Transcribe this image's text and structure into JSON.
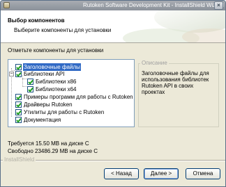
{
  "window": {
    "title": "Rutoken Software Development Kit - InstallShield Wizard",
    "close_glyph": "×"
  },
  "header": {
    "title": "Выбор компонентов",
    "subtitle": "Выберите компоненты для установки"
  },
  "instruction": "Отметьте компоненты для установки",
  "components": [
    {
      "label": "Заголовочные файлы",
      "checked": true,
      "selected": true
    },
    {
      "label": "Библиотеки API",
      "checked": true,
      "expanded": true
    },
    {
      "label": "Библиотеки x86",
      "checked": true
    },
    {
      "label": "Библиотеки x64",
      "checked": true
    },
    {
      "label": "Примеры программ для работы с Rutoken",
      "checked": true
    },
    {
      "label": "Драйверы Rutoken",
      "checked": true
    },
    {
      "label": "Утилиты для работы с Rutoken",
      "checked": true
    },
    {
      "label": "Документация",
      "checked": true
    }
  ],
  "tree_expander": "−",
  "description": {
    "legend": "Описание",
    "text": "Заголовочные файлы для использования библиотек Rutoken API в своих проектах"
  },
  "space": {
    "required": "Требуется 15.50 MB на диске C",
    "free": "Свободно 23486.29 MB на диске C"
  },
  "brand": "InstallShield",
  "buttons": {
    "back": "< Назад",
    "next": "Далее >",
    "cancel": "Отмена"
  },
  "colors": {
    "selection": "#316ac5",
    "check": "#21a121",
    "dialog": "#ece9d8"
  }
}
